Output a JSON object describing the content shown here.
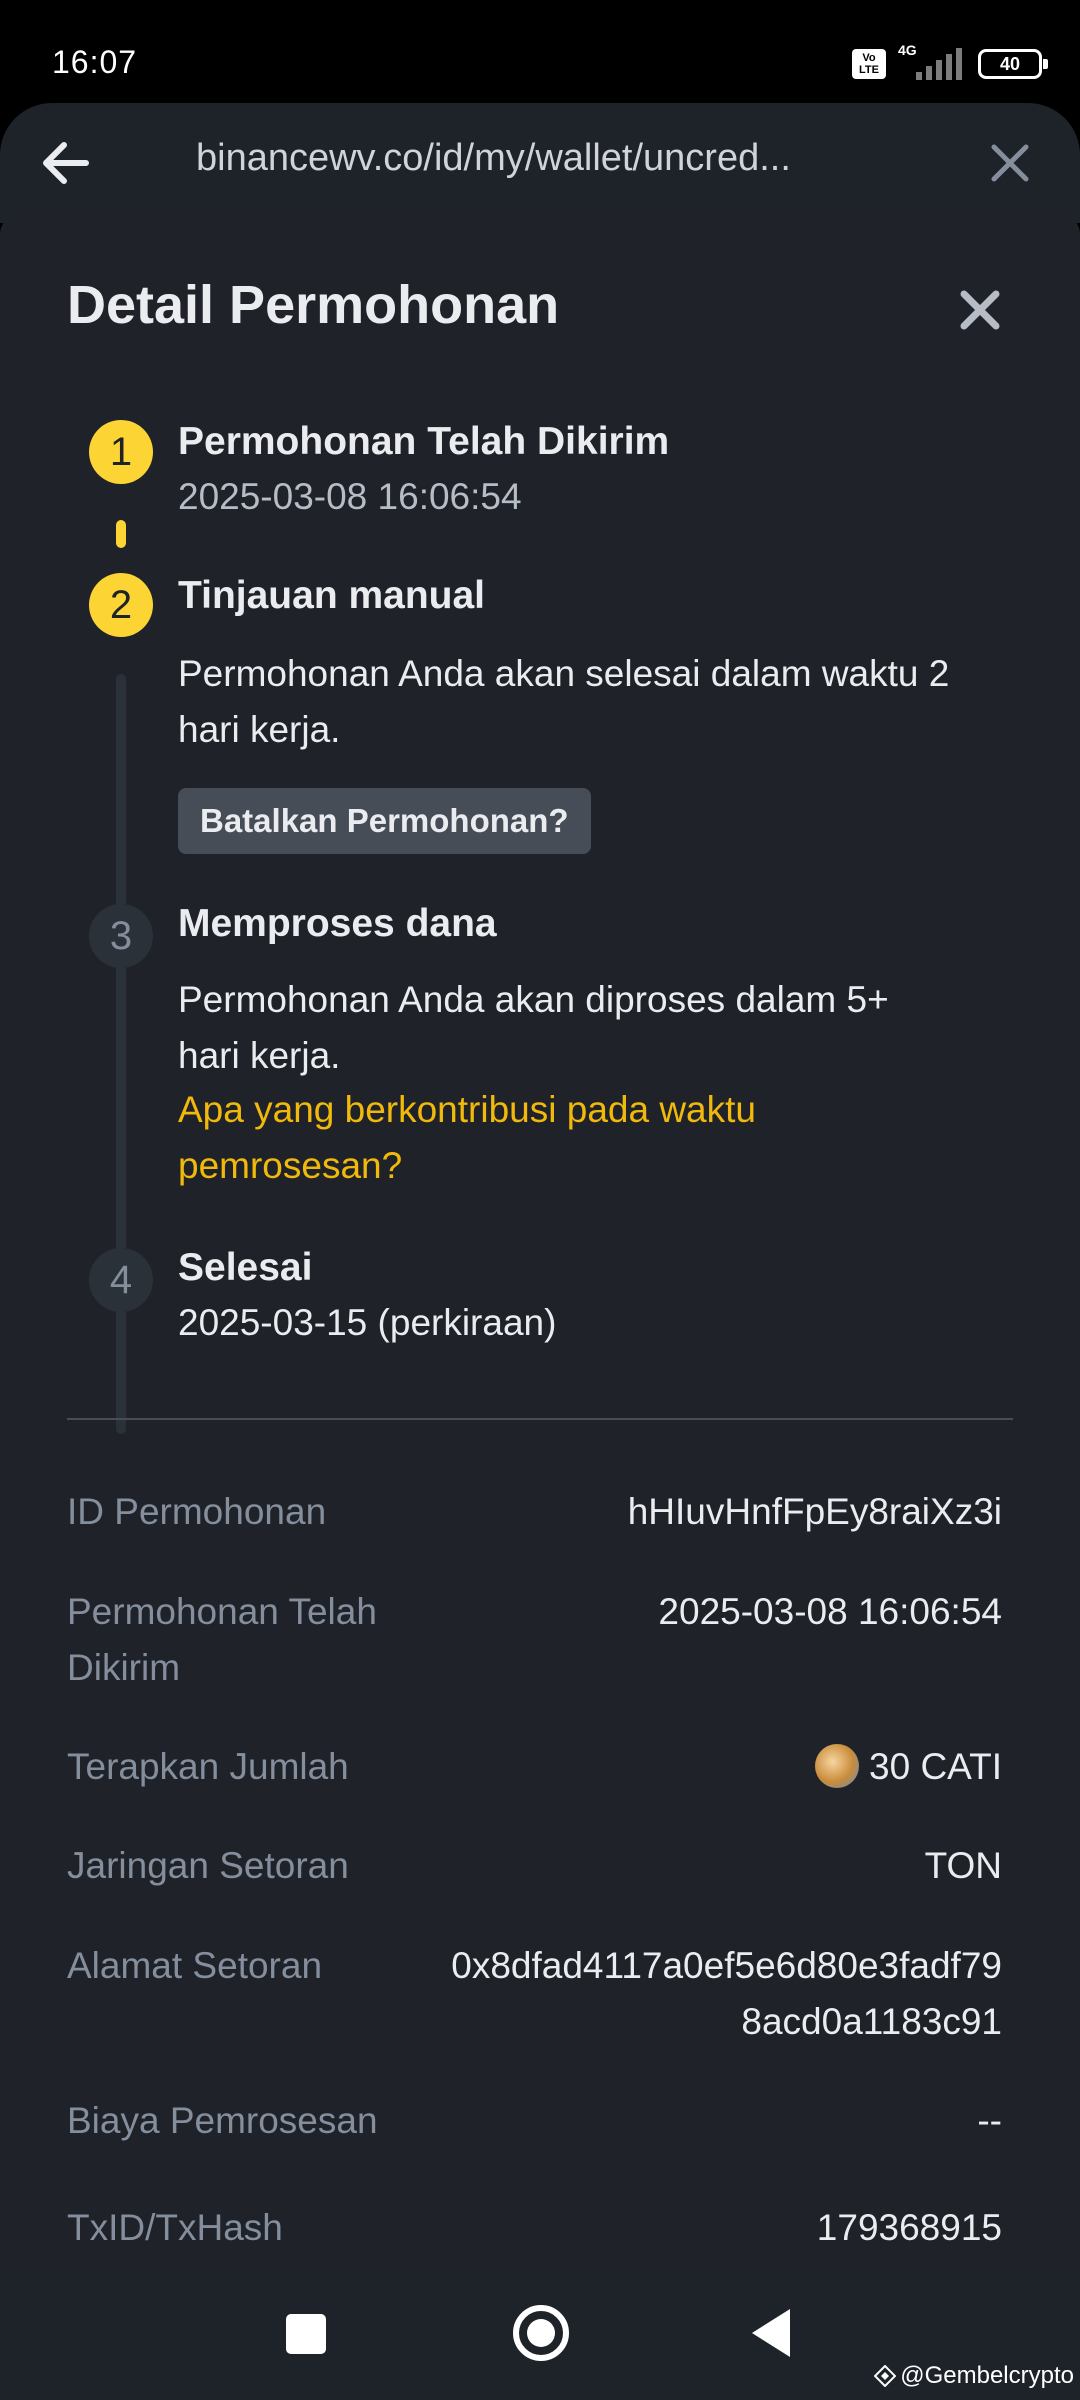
{
  "status_bar": {
    "time": "16:07",
    "volte": "Vo LTE",
    "network": "4G",
    "battery": "40"
  },
  "browser": {
    "url": "binancewv.co/id/my/wallet/uncred..."
  },
  "panel": {
    "title": "Detail Permohonan",
    "steps": [
      {
        "number": "1",
        "title": "Permohonan Telah Dikirim",
        "subtitle": "2025-03-08 16:06:54",
        "status": "done"
      },
      {
        "number": "2",
        "title": "Tinjauan manual",
        "text": "Permohonan Anda akan selesai dalam waktu 2 hari kerja.",
        "button_label": "Batalkan Permohonan?",
        "status": "active"
      },
      {
        "number": "3",
        "title": "Memproses dana",
        "text": "Permohonan Anda akan diproses dalam 5+ hari kerja.",
        "link": "Apa yang berkontribusi pada waktu pemrosesan?",
        "status": "pending"
      },
      {
        "number": "4",
        "title": "Selesai",
        "subtitle": "2025-03-15 (perkiraan)",
        "status": "pending"
      }
    ],
    "details": [
      {
        "label": "ID Permohonan",
        "value": "hHIuvHnfFpEy8raiXz3i"
      },
      {
        "label": "Permohonan Telah Dikirim",
        "value": "2025-03-08 16:06:54"
      },
      {
        "label": "Terapkan Jumlah",
        "value": "30 CATI",
        "icon": "cati-coin-icon"
      },
      {
        "label": "Jaringan Setoran",
        "value": "TON"
      },
      {
        "label": "Alamat Setoran",
        "value": "0x8dfad4117a0ef5e6d80e3fadf798acd0a1183c91"
      },
      {
        "label": "Biaya Pemrosesan",
        "value": "--"
      },
      {
        "label": "TxID/TxHash",
        "value": "179368915"
      }
    ]
  },
  "watermark": "@Gembelcrypto",
  "colors": {
    "accent": "#fcd535",
    "link": "#f0b90b",
    "background": "#1f2329",
    "muted_text": "#848e9c"
  }
}
